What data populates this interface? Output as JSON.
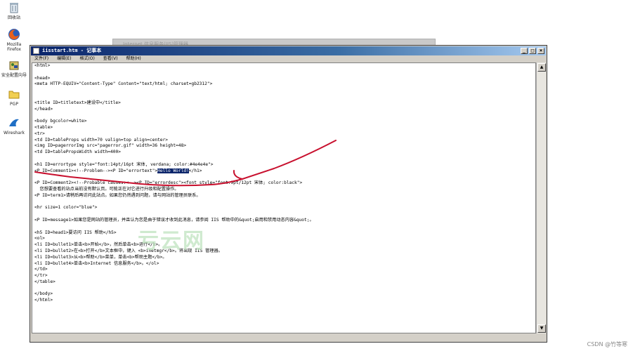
{
  "desktop": {
    "icons": [
      {
        "label": "回收站",
        "icon": "recycle-bin-icon"
      },
      {
        "label": "Mozilla Firefox",
        "icon": "firefox-icon"
      },
      {
        "label": "安全配置向导",
        "icon": "security-wizard-icon"
      },
      {
        "label": "PGP",
        "icon": "folder-icon"
      },
      {
        "label": "Wireshark",
        "icon": "wireshark-icon"
      }
    ]
  },
  "background_window": {
    "title": "Internet 信息服务(IIS)管理器"
  },
  "notepad": {
    "title": "iisstart.htm - 记事本",
    "menu": [
      "文件(F)",
      "编辑(E)",
      "格式(O)",
      "查看(V)",
      "帮助(H)"
    ],
    "lines": [
      "<html>",
      "",
      "<head>",
      "<meta HTTP-EQUIV=\"Content-Type\" Content=\"text/html; charset=gb2312\">",
      "",
      "",
      "<title ID=titletext>建设中</title>",
      "</head>",
      "",
      "<body bgcolor=white>",
      "<table>",
      "<tr>",
      "<td ID=tableProps width=70 valign=top align=center>",
      "<img ID=pagerrorImg src=\"pagerror.gif\" width=36 height=48>",
      "<td ID=tablePropsWidth width=400>",
      "",
      "<h1 ID=errortype style=\"font:14pt/16pt 宋体, verdana; color:#4e4e4e\">",
      "<P ID=Comment1><!--Problem--><P ID=\"errortext\">|Hello World!|</h1>",
      "",
      "<P ID=Comment2><!--Probable causes:<--><P ID=\"errordesc\"><font style=\"font:9pt/12pt 宋体; color:black\">",
      "  您想要查看的站点当前没有默认页。可能正在对它进行升级和配置操作。",
      "<P ID=term1>请稍后再访问此站点。如果您仍然遇到问题，请与网站的管理员联系。",
      "",
      "<hr size=1 color=\"blue\">",
      "",
      "<P ID=message1>如果您是网站的管理员，并且认为您是由于错误才收到此消息，请参阅 IIS 帮助中的&quot;启用和禁用动态内容&quot;。",
      "",
      "<h5 ID=head1>要访问 IIS 帮助</h5>",
      "<ol>",
      "<li ID=bullet1>单击<b>开始</b>，然后单击<b>运行</b>。",
      "<li ID=bullet2>在<b>打开</b>文本框中，键入 <b>inetmgr</b>。将出现 IIS 管理器。",
      "<li ID=bullet3>从<b>帮助</b>菜单，单击<b>帮助主题</b>。",
      "<li ID=bullet4>单击<b>Internet 信息服务</b>。</ol>",
      "</td>",
      "</tr>",
      "</table>",
      "",
      "</body>",
      "</html>"
    ]
  },
  "watermark": "亏云网",
  "credit": "CSDN @竹等寒",
  "colors": {
    "titlebar": "#0a246a",
    "annotation": "#c8102e",
    "selection": "#0a246a"
  }
}
